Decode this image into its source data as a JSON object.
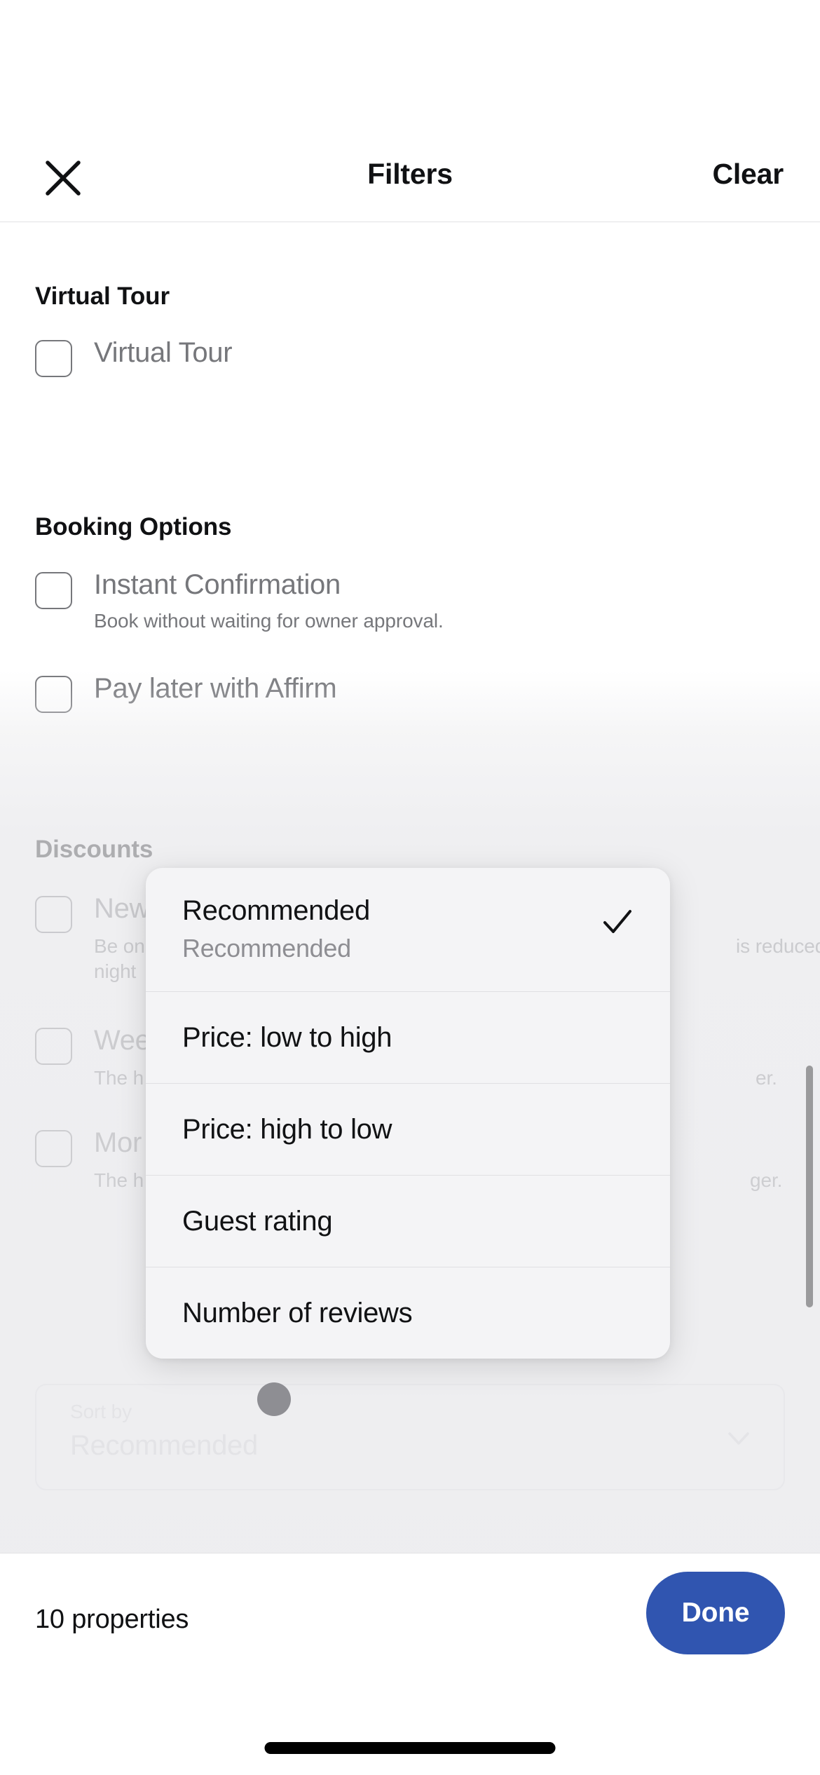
{
  "header": {
    "close_icon": "close-icon",
    "title": "Filters",
    "clear_label": "Clear"
  },
  "filters": {
    "sections": [
      {
        "title": "Virtual Tour",
        "options": [
          {
            "label": "Virtual Tour",
            "description": "",
            "checked": false
          }
        ]
      },
      {
        "title": "Booking Options",
        "options": [
          {
            "label": "Instant Confirmation",
            "description": "Book without waiting for owner approval.",
            "checked": false
          },
          {
            "label": "Pay later with Affirm",
            "description": "",
            "checked": false
          }
        ]
      },
      {
        "title": "Discounts",
        "options": [
          {
            "label": "New",
            "description_line1": "Be on",
            "description_line2": "night",
            "description_tail": "is reduced",
            "checked": false
          },
          {
            "label": "Wee",
            "description_line1": "The h",
            "description_tail": "er.",
            "checked": false
          },
          {
            "label": "Mor",
            "description_line1": "The h",
            "description_tail": "ger.",
            "checked": false
          }
        ]
      }
    ]
  },
  "sort_by": {
    "caption": "Sort by",
    "value": "Recommended",
    "chevron_icon": "chevron-down-icon"
  },
  "sort_popup": {
    "items": [
      {
        "title": "Recommended",
        "subtitle": "Recommended",
        "selected": true,
        "check_icon": "check-icon"
      },
      {
        "title": "Price: low to high",
        "subtitle": "",
        "selected": false
      },
      {
        "title": "Price: high to low",
        "subtitle": "",
        "selected": false
      },
      {
        "title": "Guest rating",
        "subtitle": "",
        "selected": false
      },
      {
        "title": "Number of reviews",
        "subtitle": "",
        "selected": false
      }
    ]
  },
  "bottom_bar": {
    "properties_count": "10 properties",
    "done_label": "Done"
  },
  "colors": {
    "accent": "#3055b0",
    "text_primary": "#101113",
    "text_muted": "#76777b",
    "popup_bg": "#f4f4f6",
    "divider": "#e2e2e4"
  }
}
